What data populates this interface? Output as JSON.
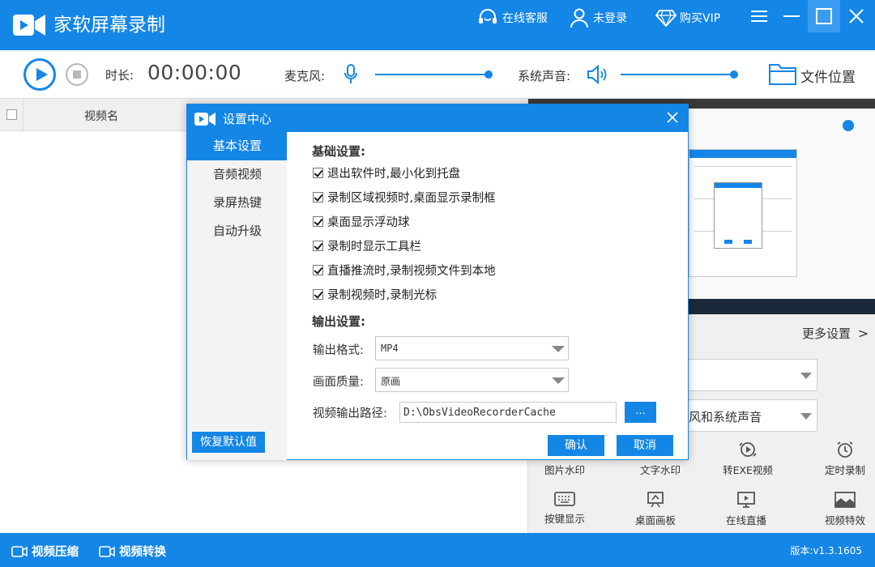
{
  "app": {
    "title": "家软屏幕录制",
    "service_label": "在线客服",
    "login_label": "未登录",
    "vip_label": "购买VIP"
  },
  "toolbar": {
    "duration_label": "时长:",
    "duration_value": "00:00:00",
    "mic_label": "麦克风:",
    "mic_level": 1.0,
    "system_sound_label": "系统声音:",
    "system_sound_level": 1.0,
    "file_location_label": "文件位置"
  },
  "list": {
    "column_name": "视频名"
  },
  "right_panel": {
    "more_settings": "更多设置",
    "audio_select_value": "风和系统声音",
    "tools": [
      {
        "label": "图片水印",
        "icon": "image-watermark-icon"
      },
      {
        "label": "文字水印",
        "icon": "text-watermark-icon"
      },
      {
        "label": "转EXE视频",
        "icon": "convert-exe-icon"
      },
      {
        "label": "定时录制",
        "icon": "alarm-clock-icon"
      },
      {
        "label": "按键显示",
        "icon": "keyboard-icon"
      },
      {
        "label": "桌面画板",
        "icon": "easel-icon"
      },
      {
        "label": "在线直播",
        "icon": "monitor-play-icon"
      },
      {
        "label": "视频特效",
        "icon": "photo-effects-icon"
      }
    ]
  },
  "dialog": {
    "title": "设置中心",
    "nav": [
      "基本设置",
      "音频视频",
      "录屏热键",
      "自动升级"
    ],
    "basic_title": "基础设置:",
    "options": [
      "退出软件时,最小化到托盘",
      "录制区域视频时,桌面显示录制框",
      "桌面显示浮动球",
      "录制时显示工具栏",
      "直播推流时,录制视频文件到本地",
      "录制视频时,录制光标"
    ],
    "output_title": "输出设置:",
    "format_label": "输出格式:",
    "format_value": "MP4",
    "quality_label": "画面质量:",
    "quality_value": "原画",
    "path_label": "视频输出路径:",
    "path_value": "D:\\ObsVideoRecorderCache",
    "browse_label": "...",
    "reset_label": "恢复默认值",
    "ok_label": "确认",
    "cancel_label": "取消"
  },
  "status": {
    "compress_label": "视频压缩",
    "convert_label": "视频转换",
    "version": "版本:v1.3.1605"
  },
  "colors": {
    "accent": "#1486e6",
    "panel_bg": "#f0f0f0"
  }
}
